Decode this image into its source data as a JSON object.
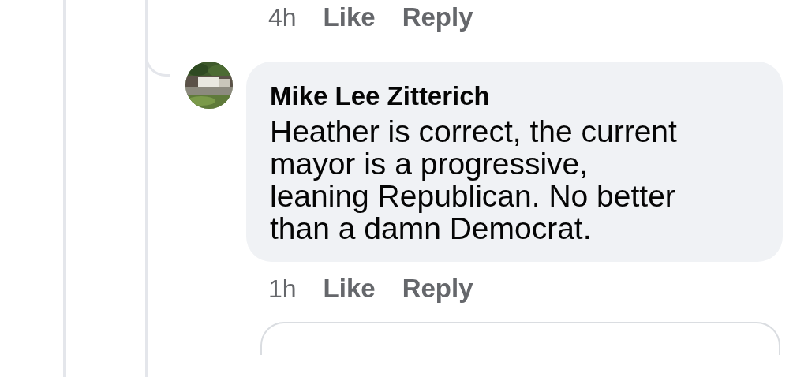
{
  "previous_comment": {
    "actions": [
      {
        "kind": "time",
        "label": "4h"
      },
      {
        "kind": "link",
        "label": "Like"
      },
      {
        "kind": "link",
        "label": "Reply"
      }
    ]
  },
  "comment": {
    "author": "Mike Lee Zitterich",
    "body_lines": [
      "Heather is correct, the current",
      "mayor is a progressive,",
      "leaning Republican. No better",
      "than a damn Democrat."
    ],
    "actions": [
      {
        "kind": "time",
        "label": "1h"
      },
      {
        "kind": "link",
        "label": "Like"
      },
      {
        "kind": "link",
        "label": "Reply"
      }
    ]
  },
  "reply_field": {
    "kind": "field"
  }
}
